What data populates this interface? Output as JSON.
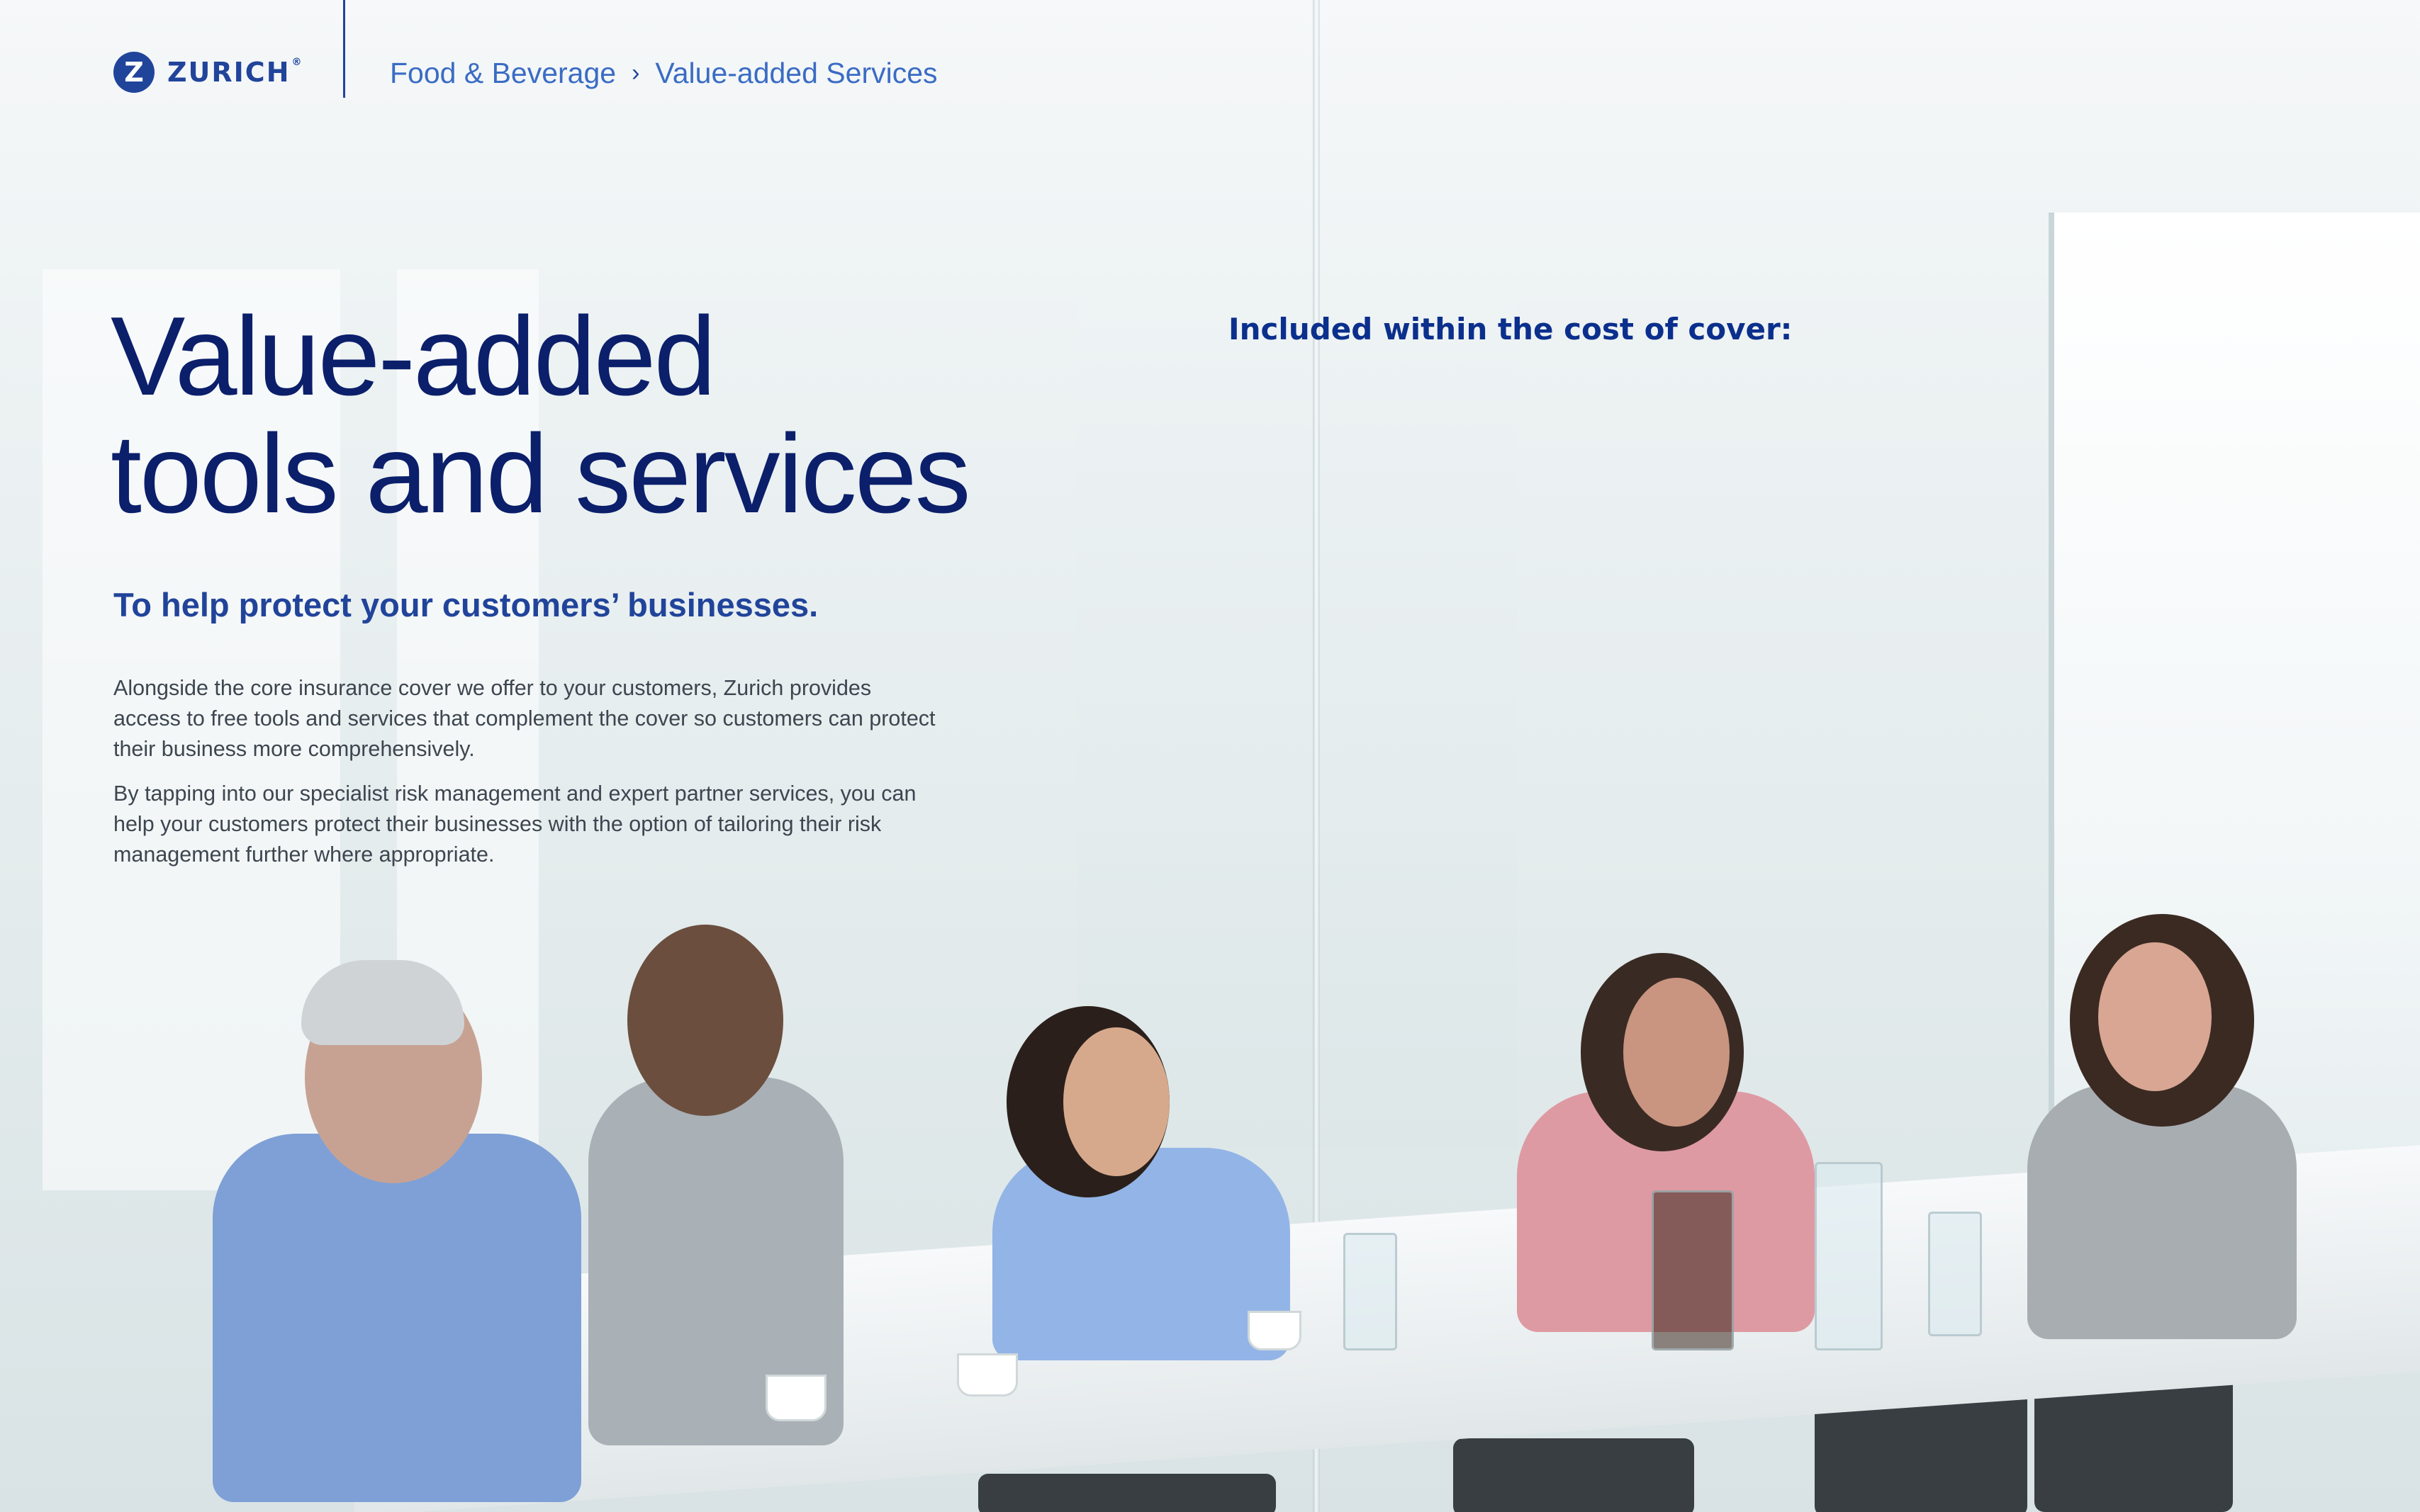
{
  "header": {
    "logo_text": "ZURICH",
    "logo_mark": "Z",
    "logo_reg": "®",
    "breadcrumb": [
      "Food & Beverage",
      "Value-added Services"
    ],
    "breadcrumb_separator": "›"
  },
  "main": {
    "title_line1": "Value-added",
    "title_line2": "tools and services",
    "subtitle": "To help protect your customers’ businesses.",
    "paragraphs": [
      "Alongside the core insurance cover we offer to your customers, Zurich provides access to free tools and services that complement the cover so customers can protect their business more comprehensively.",
      "By tapping into our specialist risk management and expert partner services, you can help your customers protect their businesses with the option of tailoring their risk management further where appropriate."
    ]
  },
  "right_column": {
    "heading": "Included within the cost of cover:"
  },
  "colors": {
    "brand_blue": "#21449b",
    "title_navy": "#0b1f6b",
    "link_blue": "#3a6cc4",
    "body_gray": "#3d4650"
  }
}
